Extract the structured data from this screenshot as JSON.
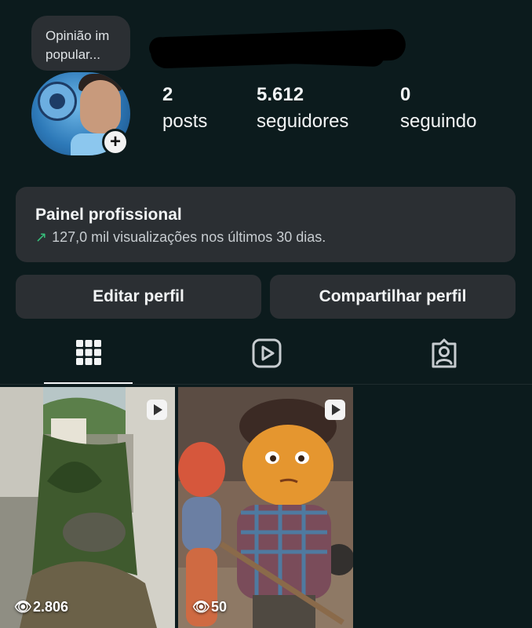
{
  "note": {
    "text": "Opinião im popular..."
  },
  "profile": {
    "stats": [
      {
        "num": "2",
        "label": "posts"
      },
      {
        "num": "5.612",
        "label": "seguidores"
      },
      {
        "num": "0",
        "label": "seguindo"
      }
    ]
  },
  "professional_dashboard": {
    "title": "Painel profissional",
    "subtitle": "127,0 mil visualizações nos últimos 30 dias."
  },
  "buttons": {
    "edit": "Editar perfil",
    "share": "Compartilhar perfil"
  },
  "tabs": [
    {
      "icon": "grid-icon",
      "active": true
    },
    {
      "icon": "reels-icon",
      "active": false
    },
    {
      "icon": "tagged-icon",
      "active": false
    }
  ],
  "posts": [
    {
      "views": "2.806",
      "type": "reel"
    },
    {
      "views": "50",
      "type": "reel"
    }
  ],
  "colors": {
    "background": "#0c1b1d",
    "card": "#2b2f33",
    "accent_up": "#37c27c"
  }
}
